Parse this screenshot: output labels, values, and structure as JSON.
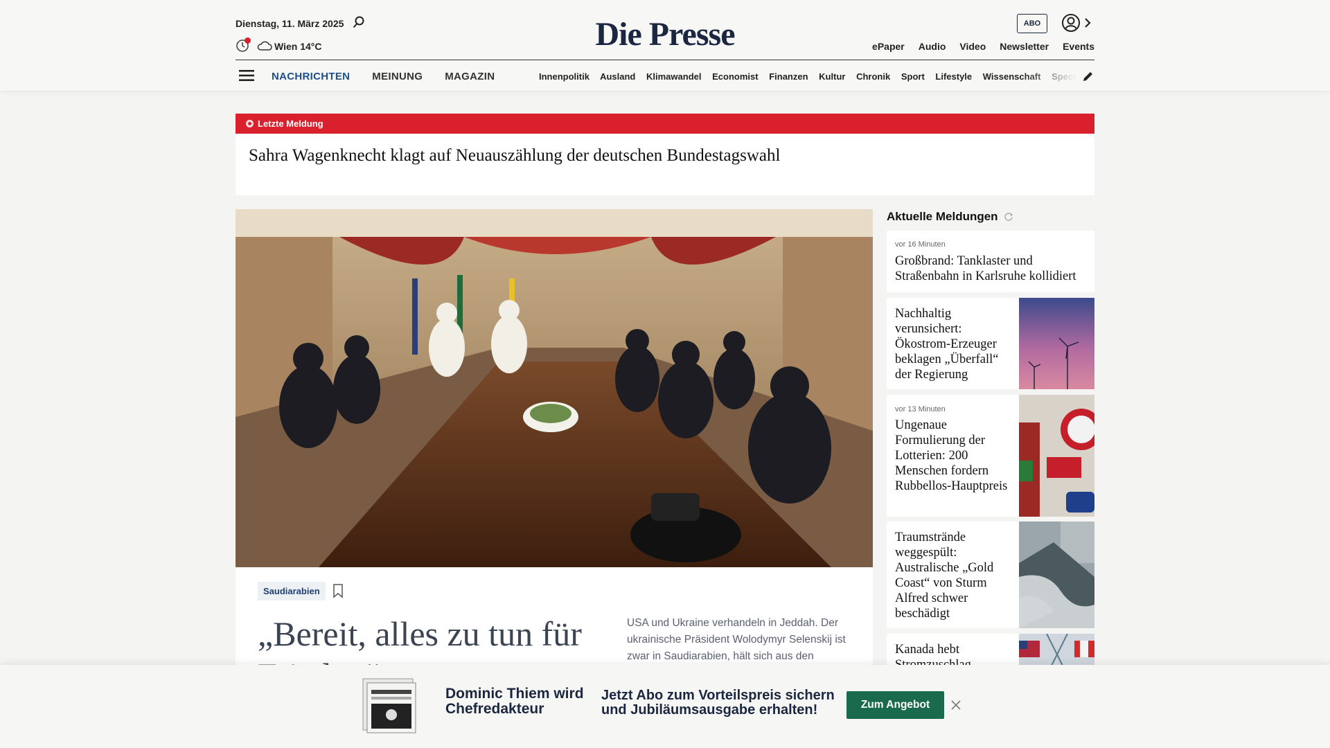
{
  "header": {
    "date": "Dienstag, 11. März 2025",
    "weather": "Wien 14°C",
    "logo": "Die Presse",
    "abo_label": "ABO",
    "top_links": [
      "ePaper",
      "Audio",
      "Video",
      "Newsletter",
      "Events"
    ],
    "main_nav": [
      "NACHRICHTEN",
      "MEINUNG",
      "MAGAZIN"
    ],
    "sub_nav": [
      "Innenpolitik",
      "Ausland",
      "Klimawandel",
      "Economist",
      "Finanzen",
      "Kultur",
      "Chronik",
      "Sport",
      "Lifestyle",
      "Wissenschaft",
      "Spectrum"
    ]
  },
  "breaking": {
    "label": "Letzte Meldung",
    "headline": "Sahra Wagenknecht klagt auf Neuauszählung der deutschen Bundestagswahl"
  },
  "hero": {
    "tag": "Saudiarabien",
    "title": "„Bereit, alles zu tun für Frieden“",
    "lead": "USA und Ukraine verhandeln in Jeddah. Der ukrainische Präsident Wolodymyr Selenskij ist zwar in Saudiarabien, hält sich aus den"
  },
  "sidebar": {
    "title": "Aktuelle Meldungen",
    "items": [
      {
        "meta": "vor 16 Minuten",
        "title": "Großbrand: Tanklaster und Straßenbahn in Karlsruhe kollidiert"
      },
      {
        "meta": "",
        "title": "Nachhaltig verunsichert: Ökostrom-Erzeuger beklagen „Überfall“ der Regierung"
      },
      {
        "meta": "vor 13 Minuten",
        "title": "Ungenaue Formulierung der Lotterien: 200 Menschen fordern Rubbellos-Hauptpreis"
      },
      {
        "meta": "",
        "title": "Traumstrände weggespült: Australische „Gold Coast“ von Sturm Alfred schwer beschädigt"
      },
      {
        "meta": "",
        "title": "Kanada hebt Stromzuschlag"
      }
    ]
  },
  "promo": {
    "name": "Dominic Thiem wird Chefredakteur",
    "text": "Jetzt Abo zum Vorteilspreis sichern und Jubiläumsausgabe erhalten!",
    "button": "Zum Angebot"
  }
}
